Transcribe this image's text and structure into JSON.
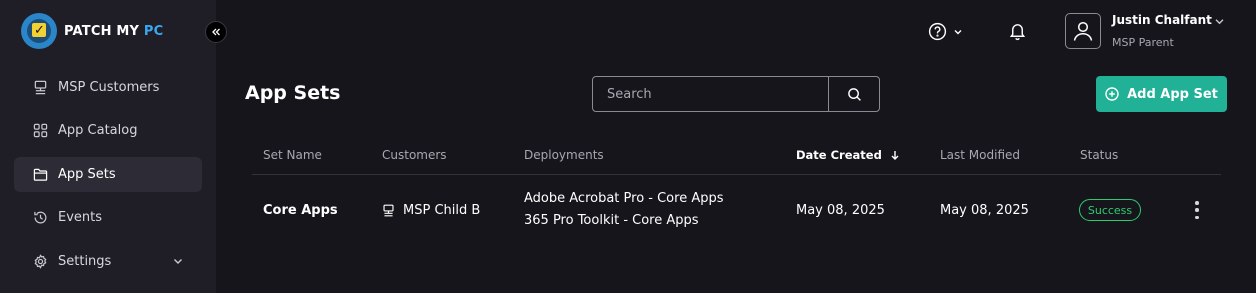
{
  "brand": {
    "name_part1": "PATCH MY ",
    "name_part2": "PC"
  },
  "sidebar": {
    "items": [
      {
        "label": "MSP Customers",
        "icon": "network-icon",
        "active": false
      },
      {
        "label": "App Catalog",
        "icon": "grid-icon",
        "active": false
      },
      {
        "label": "App Sets",
        "icon": "folder-icon",
        "active": true
      },
      {
        "label": "Events",
        "icon": "history-icon",
        "active": false
      },
      {
        "label": "Settings",
        "icon": "gear-icon",
        "active": false
      }
    ]
  },
  "user": {
    "name": "Justin Chalfant",
    "role": "MSP Parent"
  },
  "page": {
    "title": "App Sets"
  },
  "search": {
    "placeholder": "Search",
    "value": ""
  },
  "actions": {
    "add_label": "Add App Set"
  },
  "table": {
    "columns": [
      "Set Name",
      "Customers",
      "Deployments",
      "Date Created",
      "Last Modified",
      "Status"
    ],
    "sorted_column": "Date Created",
    "sort_direction": "descending",
    "rows": [
      {
        "set_name": "Core Apps",
        "customer": "MSP Child B",
        "deployments": [
          "Adobe Acrobat Pro - Core Apps",
          "365 Pro Toolkit - Core Apps"
        ],
        "date_created": "May 08, 2025",
        "last_modified": "May 08, 2025",
        "status": "Success"
      }
    ]
  },
  "colors": {
    "accent": "#20b196",
    "success": "#2ecc71",
    "background": "#16151b",
    "sidebar": "#1f1e26",
    "brand_blue": "#38a9f0"
  }
}
